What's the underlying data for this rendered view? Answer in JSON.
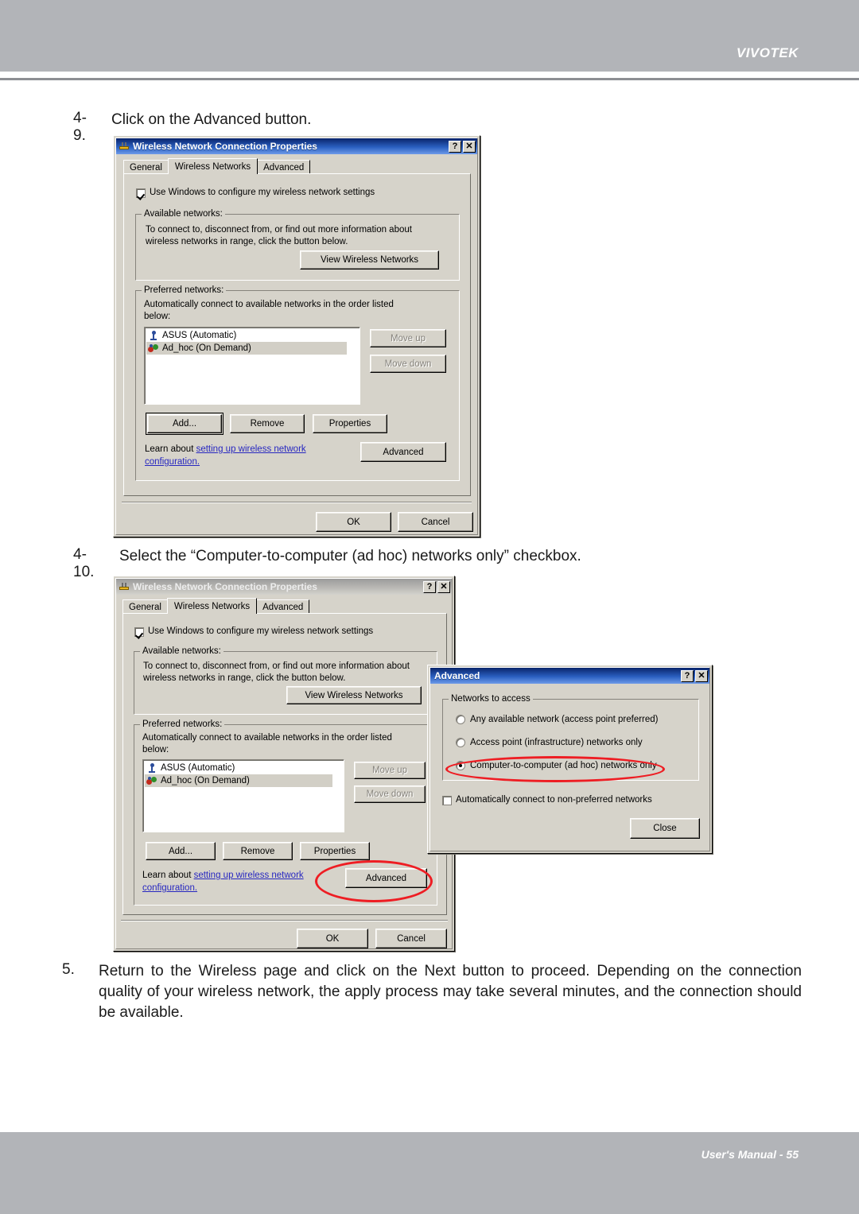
{
  "page": {
    "brand": "VIVOTEK",
    "footer": "User's Manual - 55"
  },
  "steps": [
    {
      "number": "4-9.",
      "text": "Click on the Advanced button."
    },
    {
      "number": "4-10.",
      "text": "Select the “Computer-to-computer (ad hoc) networks only” checkbox."
    },
    {
      "number": "5.",
      "text": "Return to the Wireless page and click on the Next button to proceed. Depending on the connection quality of your wireless network, the apply process may take several minutes, and the connection should be available."
    }
  ],
  "wireless_dialog": {
    "title": "Wireless Network Connection Properties",
    "titlebar_buttons": {
      "help": "?",
      "close": "✕"
    },
    "tabs": [
      {
        "label": "General"
      },
      {
        "label": "Wireless Networks"
      },
      {
        "label": "Advanced"
      }
    ],
    "active_tab": "Wireless Networks",
    "use_windows_checkbox": {
      "label": "Use Windows to configure my wireless network settings",
      "checked": true
    },
    "available": {
      "group_label": "Available networks:",
      "description_line1": "To connect to, disconnect from, or find out more information about",
      "description_line2": "wireless networks in range, click the button below.",
      "view_button": "View Wireless Networks"
    },
    "preferred": {
      "group_label": "Preferred networks:",
      "description_line1": "Automatically connect to available networks in the order listed",
      "description_line2": "below:",
      "items": [
        {
          "name": "ASUS (Automatic)",
          "icon": "access-point-icon",
          "selected": false
        },
        {
          "name": "Ad_hoc (On Demand)",
          "icon": "ad-hoc-icon",
          "selected": true
        }
      ],
      "move_up": "Move up",
      "move_down": "Move down",
      "add": "Add...",
      "remove": "Remove",
      "properties": "Properties"
    },
    "learn": {
      "prefix": "Learn about ",
      "link_line1": "setting up wireless network",
      "link_line2": "configuration.",
      "advanced_button": "Advanced"
    },
    "ok": "OK",
    "cancel": "Cancel"
  },
  "advanced_dialog": {
    "title": "Advanced",
    "titlebar_buttons": {
      "help": "?",
      "close": "✕"
    },
    "group_label": "Networks to access",
    "radios": [
      {
        "label": "Any available network (access point preferred)",
        "selected": false
      },
      {
        "label": "Access point (infrastructure) networks only",
        "selected": false
      },
      {
        "label": "Computer-to-computer (ad hoc) networks only",
        "selected": true
      }
    ],
    "auto_connect_checkbox": {
      "label": "Automatically connect to non-preferred networks",
      "checked": false
    },
    "close_button": "Close"
  },
  "annotations": {
    "highlight_color": "#ee1d23",
    "targets": [
      "advanced-button",
      "computer-to-computer-radio"
    ]
  }
}
